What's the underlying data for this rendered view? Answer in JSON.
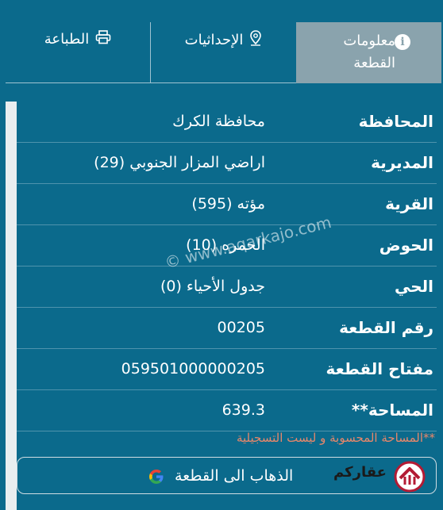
{
  "tabs": {
    "print": {
      "label": "الطباعة",
      "icon": "printer-icon"
    },
    "coordinates": {
      "label": "الإحداثيات",
      "icon": "map-pin-icon"
    },
    "info": {
      "label_line1": "معلومات",
      "label_line2": "القطعة",
      "icon": "info-icon",
      "active": true
    }
  },
  "rows": [
    {
      "label": "المحافظة",
      "value": "محافظة الكرك"
    },
    {
      "label": "المديرية",
      "value": "اراضي المزار الجنوبي (29)"
    },
    {
      "label": "القرية",
      "value": "مؤته (595)"
    },
    {
      "label": "الحوض",
      "value": "الحمره (10)"
    },
    {
      "label": "الحي",
      "value": "جدول الأحياء (0)"
    },
    {
      "label": "رقم القطعة",
      "value": "00205"
    },
    {
      "label": "مفتاح القطعة",
      "value": "059501000000205"
    },
    {
      "label": "**المساحة",
      "value": "639.3"
    }
  ],
  "note": "**المساحة المحسوبة و ليست التسجيلية",
  "go_button": {
    "label": "الذهاب الى القطعة",
    "icon": "google-icon"
  },
  "watermark": "© www.aqarkajo.com",
  "colors": {
    "background": "#0b6a8c",
    "active_tab": "#8aa3ad",
    "note": "#e8876a"
  }
}
